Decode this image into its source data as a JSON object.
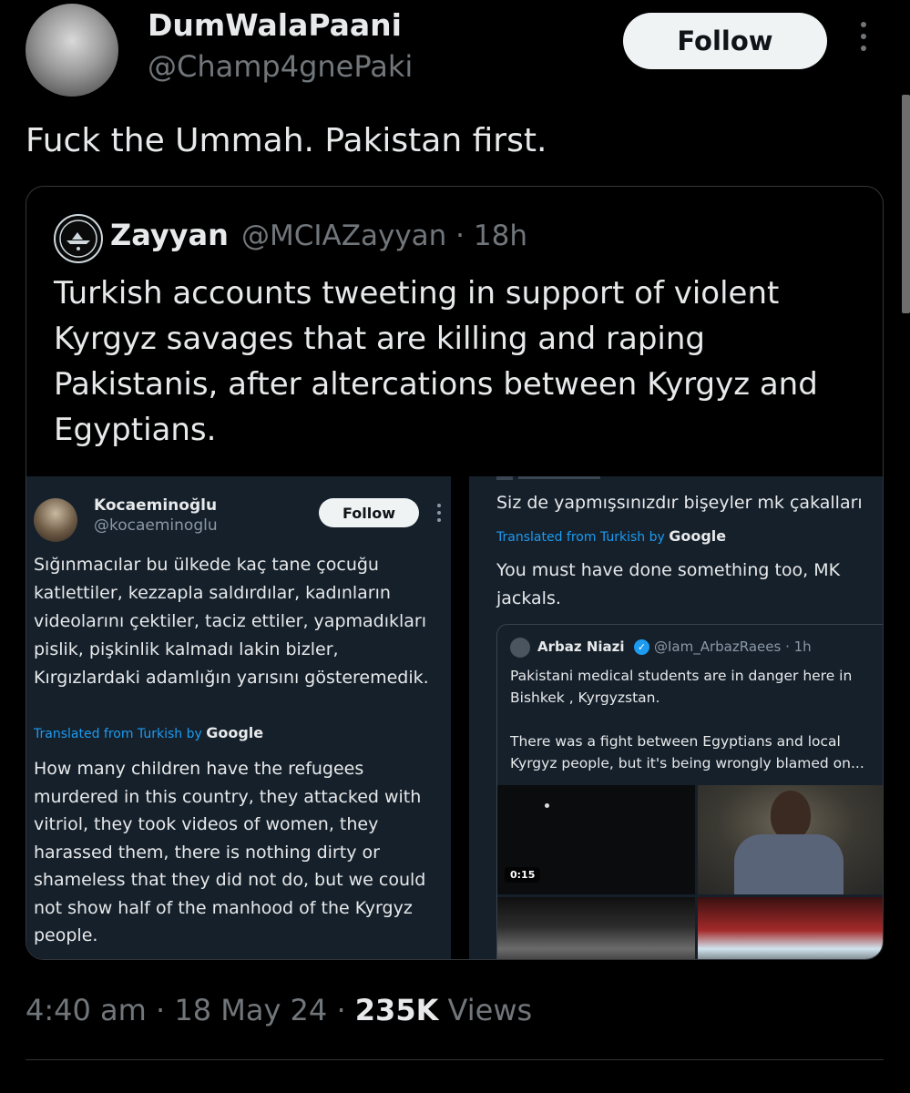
{
  "tweet": {
    "author": {
      "display_name": "DumWalaPaani",
      "handle": "@Champ4gnePaki"
    },
    "follow_label": "Follow",
    "text": "Fuck the Ummah. Pakistan first.",
    "timestamp": "4:40 am · 18 May 24 ·",
    "views_count": "235K",
    "views_label": "Views"
  },
  "quoted": {
    "name": "Zayyan",
    "meta": "@MCIAZayyan · 18h",
    "text": "Turkish accounts tweeting in support of violent Kyrgyz savages that are killing and raping Pakistanis, after altercations between Kyrgyz and Egyptians."
  },
  "screenshot_left": {
    "name": "Kocaeminoğlu",
    "handle": "@kocaeminoglu",
    "follow_label": "Follow",
    "original_text": "Sığınmacılar bu ülkede kaç tane çocuğu katlettiler, kezzapla saldırdılar, kadınların videolarını çektiler, taciz ettiler, yapmadıkları pislik, pişkinlik kalmadı lakin bizler, Kırgızlardaki adamlığın yarısını gösteremedik.",
    "translated_label": "Translated from Turkish by",
    "translator": "Google",
    "translated_text": "How many children have the refugees murdered in this country, they attacked with vitriol, they took videos of women, they harassed them, there is nothing dirty or shameless that they did not do, but we could not show half of the manhood of the Kyrgyz people."
  },
  "screenshot_right": {
    "original_text": "Siz de yapmışsınızdır bişeyler mk çakalları",
    "translated_label": "Translated from Turkish by",
    "translator": "Google",
    "translated_text": "You must have done something too, MK jackals.",
    "inner": {
      "name": "Arbaz Niazi",
      "verified_icon": "✓",
      "meta": "@Iam_ArbazRaees · 1h",
      "text": "Pakistani medical students are in danger here in Bishkek , Kyrgyzstan.\n\nThere was a fight between Egyptians and local Kyrgyz people, but it's being wrongly blamed on...",
      "video_duration": "0:15"
    }
  },
  "colors": {
    "background": "#000000",
    "text": "#e7e9ea",
    "muted": "#71767b",
    "link_blue": "#1d9bf0",
    "dim_panel": "#15202b"
  }
}
